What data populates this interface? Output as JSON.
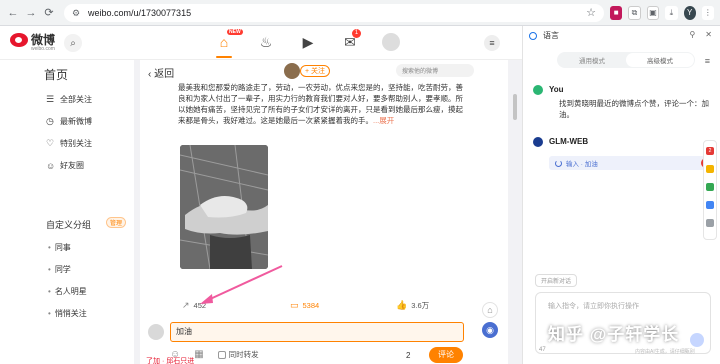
{
  "browser": {
    "url": "weibo.com/u/1730077315"
  },
  "weibo": {
    "logo_text": "微博",
    "logo_domain": "weibo.com",
    "nav_new_badge": "NEW",
    "nav_msg_badge": "1",
    "sidebar": {
      "title": "首页",
      "items": [
        "全部关注",
        "最新微博",
        "特别关注",
        "好友圈"
      ],
      "group_title": "自定义分组",
      "group_manage": "管理",
      "groups": [
        "同事",
        "同学",
        "名人明星",
        "悄悄关注"
      ]
    },
    "feed": {
      "back_label": "返回",
      "follow_label": "+ 关注",
      "search_placeholder": "搜索他的微博",
      "post_text": "最美我和您那爱的路途走了，劳动，一农劳动，优点来您是的，坚持能，吃苦耐劳，善良和为家人付出了一辈子，用实力行的教育我们要对人好，要多帮助别人，要孝顺。所以她她有痛苦，坚持见完了所有的子女们才安详的离开，只是看到她最后那么瘦，摸起来都是骨头，我好难过。这是她最后一次紧紧握着我的手。",
      "more_label": "...展开",
      "stats": {
        "reposts": "452",
        "comments": "5384",
        "likes": "3.6万"
      },
      "comment_input": "加油",
      "repost_checkbox": "同时转发",
      "comment_count": "2",
      "comment_button": "评论",
      "next_row": "了加 · 邱石只进"
    }
  },
  "panel": {
    "title": "语言",
    "modes": [
      "通用模式",
      "高级模式"
    ],
    "messages": [
      {
        "author": "You",
        "text": "找到黄晓明最近的微博点个赞，评论一个：加油。"
      },
      {
        "author": "GLM-WEB",
        "text": ""
      }
    ],
    "step_label": "输入 · 加油",
    "new_chat": "开启新对话",
    "input_placeholder": "输入指令，请立即你执行操作",
    "footer_num": "47",
    "footer_note": "内容由AI生成，请仔细甄别"
  },
  "watermark": "知乎 @子轩学长",
  "colors": {
    "accent": "#ff8200",
    "weibo_red": "#e6162d",
    "panel_blue": "#1a73e8"
  }
}
